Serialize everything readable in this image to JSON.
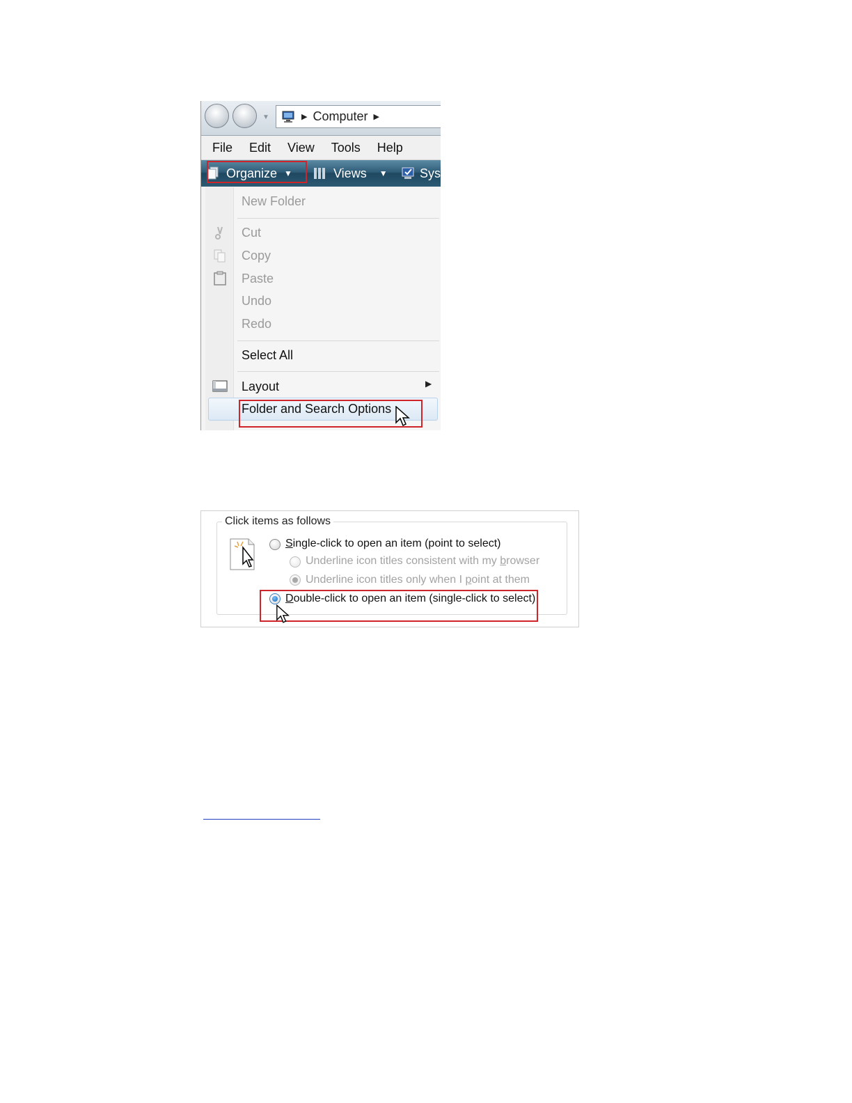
{
  "explorer": {
    "address": {
      "icon": "computer-icon",
      "location": "Computer"
    },
    "menubar": [
      "File",
      "Edit",
      "View",
      "Tools",
      "Help"
    ],
    "toolbar": {
      "organize": "Organize",
      "views": "Views",
      "system": "Sys"
    },
    "organize_menu": {
      "new_folder": "New Folder",
      "cut": "Cut",
      "copy": "Copy",
      "paste": "Paste",
      "undo": "Undo",
      "redo": "Redo",
      "select_all": "Select All",
      "layout": "Layout",
      "folder_options": "Folder and Search Options"
    },
    "colors": {
      "highlight_box": "#d0242b",
      "toolbar": "#2f5d78"
    }
  },
  "folder_options": {
    "group_title": "Click items as follows",
    "single_click_pre": "",
    "single_click_key": "S",
    "single_click_rest": "ingle-click to open an item (point to select)",
    "underline_consistent_pre": "Underline icon titles consistent with my ",
    "underline_consistent_key": "b",
    "underline_consistent_rest": "rowser",
    "underline_point_pre": "Underline icon titles only when I ",
    "underline_point_key": "p",
    "underline_point_rest": "oint at them",
    "double_click_key": "D",
    "double_click_rest": "ouble-click to open an item (single-click to select)",
    "selected_option": "double-click"
  }
}
